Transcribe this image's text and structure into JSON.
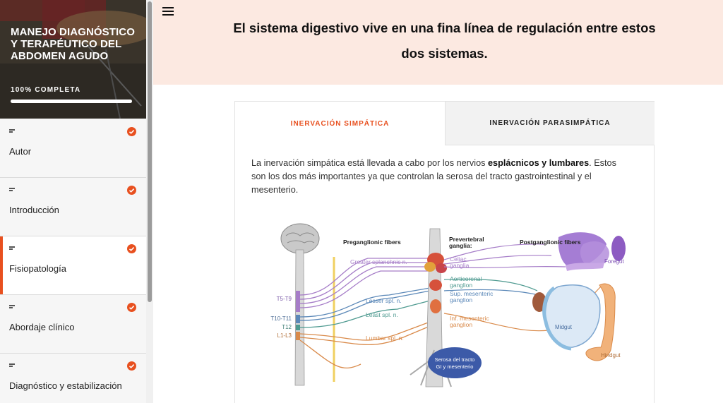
{
  "sidebar": {
    "course_title": "MANEJO DIAGNÓSTICO Y TERAPÉUTICO DEL ABDOMEN AGUDO",
    "progress_label": "100% COMPLETA",
    "progress": 100,
    "items": [
      {
        "label": "Autor",
        "completed": true
      },
      {
        "label": "Introducción",
        "completed": true
      },
      {
        "label": "Fisiopatología",
        "completed": true,
        "active": true
      },
      {
        "label": "Abordaje clínico",
        "completed": true
      },
      {
        "label": "Diagnóstico y estabilización",
        "completed": true
      }
    ]
  },
  "hero": {
    "heading": "El sistema digestivo vive en una fina línea de regulación entre estos dos sistemas."
  },
  "tabs": [
    {
      "label": "INERVACIÓN SIMPÁTICA",
      "active": true
    },
    {
      "label": "INERVACIÓN PARASIMPÁTICA",
      "active": false
    }
  ],
  "tab_content": {
    "text_before": "La inervación simpática está llevada a cabo por los nervios ",
    "text_bold": "esplácnicos y lumbares",
    "text_after": ". Estos son los dos más importantes ya que controlan la serosa del tracto gastrointestinal y el mesenterio."
  },
  "diagram": {
    "preganglionic": "Preganglionic fibers",
    "prevertebral_1": "Prevertebral",
    "prevertebral_2": "ganglia:",
    "postganglionic": "Postganglionic fibers",
    "greater": "Greater splanchnic n.",
    "lesser": "Lesser spl. n.",
    "least": "Least spl. n.",
    "lumbar": "Lumbar spl. n.",
    "celiac_1": "Celiac",
    "celiac_2": "ganglia",
    "aortic_1": "Aorticorenal",
    "aortic_2": "ganglion",
    "supmes_1": "Sup. mesenteric",
    "supmes_2": "ganglion",
    "infmes_1": "Inf. mesenteric",
    "infmes_2": "ganglion",
    "t5": "T5-T9",
    "t10": "T10-T11",
    "t12": "T12",
    "l1": "L1-L3",
    "serosa_1": "Serosa del tracto",
    "serosa_2": "GI y mesenterio",
    "foregut": "Foregut",
    "midgut": "Midgut",
    "hindgut": "Hindgut"
  },
  "colors": {
    "accent": "#e8501f",
    "hero_bg": "#fce9e1",
    "purple": "#a67dc8",
    "blue": "#5b88b8",
    "teal": "#4e9a90",
    "orange": "#d98a4a"
  }
}
